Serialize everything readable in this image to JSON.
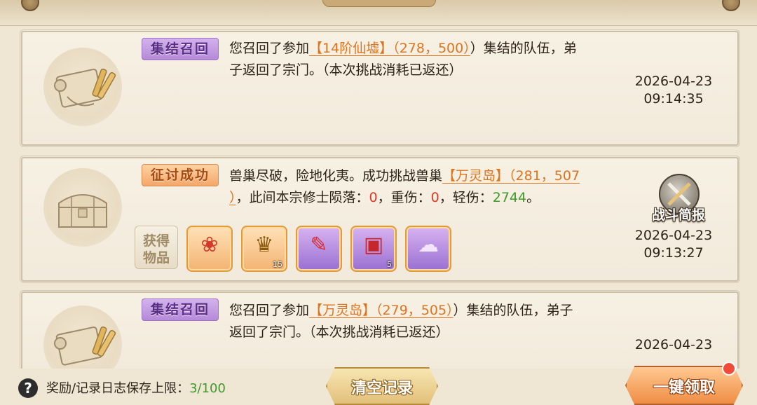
{
  "entries": [
    {
      "tag": "集结召回",
      "line1_pre": "您召回了参加",
      "location": "【14阶仙墟】（278，500）",
      "line1_post": "）集结的队伍，弟",
      "line2": "子返回了宗门。（本次挑战消耗已返还）",
      "date": "2026-04-23",
      "time": "09:14:35"
    },
    {
      "tag": "征讨成功",
      "line1_pre": "兽巢尽破，险地化夷。成功挑战兽巢",
      "location": "【万灵岛】（281，507",
      "line2_close": "）",
      "line2_a": "，此间本宗修士陨落：",
      "dead": "0",
      "line2_b": "，重伤：",
      "severe": "0",
      "line2_c": "，轻伤：",
      "light": "2744",
      "line2_d": "。",
      "report_label": "战斗简报",
      "items_label_1": "获得",
      "items_label_2": "物品",
      "items": [
        {
          "icon": "lion-dance-icon",
          "qty": ""
        },
        {
          "icon": "golden-tiger-icon",
          "qty": "15"
        },
        {
          "icon": "scroll-icon",
          "qty": ""
        },
        {
          "icon": "treasure-chest-icon",
          "qty": "5"
        },
        {
          "icon": "spirit-cloud-icon",
          "qty": ""
        }
      ],
      "date": "2026-04-23",
      "time": "09:13:27"
    },
    {
      "tag": "集结召回",
      "line1_pre": "您召回了参加",
      "location": "【万灵岛】（279，505）",
      "line1_post": "）集结的队伍，弟子",
      "line2": "返回了宗门。（本次挑战消耗已返还）",
      "date": "2026-04-23"
    }
  ],
  "footer": {
    "limit_label": "奖励/记录日志保存上限：",
    "limit_value": "3/100",
    "clear_label": "清空记录",
    "claim_label": "一键领取"
  }
}
